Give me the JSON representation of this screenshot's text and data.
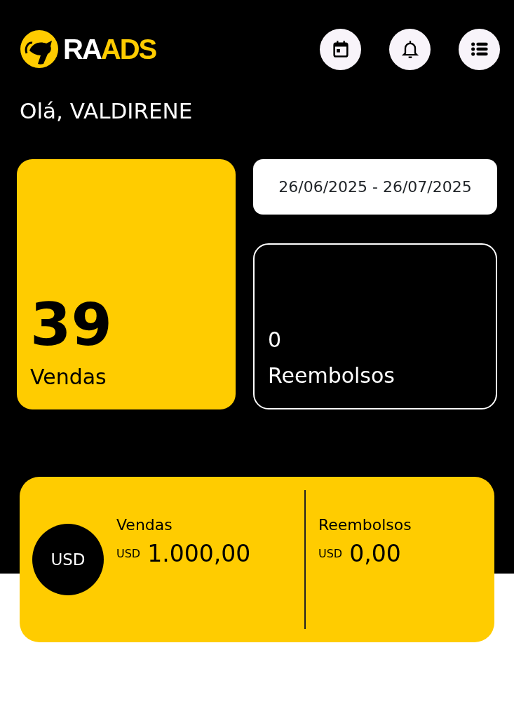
{
  "logo": {
    "parts": [
      {
        "text": "RA",
        "color": "#ffffff"
      },
      {
        "text": "ADS",
        "color": "#ffcc00"
      }
    ]
  },
  "header_buttons": [
    {
      "kind": "calendar"
    },
    {
      "kind": "bell"
    },
    {
      "kind": "list"
    }
  ],
  "greeting": "Olá, VALDIRENE",
  "sales_card": {
    "value": "39",
    "label": "Vendas"
  },
  "date_range": "26/06/2025 - 26/07/2025",
  "refunds_card": {
    "value": "0",
    "label": "Reembolsos"
  },
  "summary": {
    "currency_badge": "USD",
    "columns": [
      {
        "label": "Vendas",
        "currency": "USD",
        "amount": "1.000,00"
      },
      {
        "label": "Reembolsos",
        "currency": "USD",
        "amount": "0,00"
      }
    ]
  }
}
